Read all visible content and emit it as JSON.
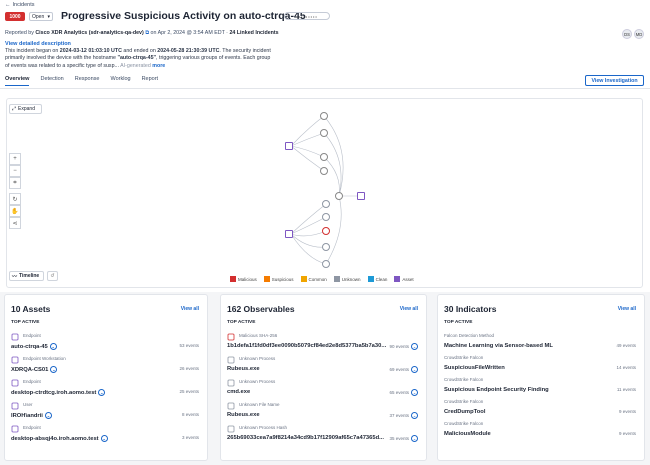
{
  "breadcrumb": "Incidents",
  "header": {
    "severity_score": "1000",
    "status": "Open",
    "title": "Progressive Suspicious Activity on auto-ctrqa-45",
    "more_label": "•••••••••"
  },
  "meta": {
    "reported_by_prefix": "Reported by",
    "reporter": "Cisco XDR Analytics (sdr-analytics-qa-dev)",
    "date_prefix": "on Apr 2, 2024 @ 3:54 AM EDT ·",
    "linked": "24 Linked Incidents"
  },
  "avatars": [
    "DS",
    "MD"
  ],
  "view_description": "View detailed description",
  "description": {
    "p1": "This incident began on ",
    "start": "2024-03-12 01:03:10 UTC",
    "p2": " and ended on ",
    "end": "2024-05-28 21:30:39 UTC",
    "p3": ". The security incident primarily involved the device with the hostname ",
    "host": "\"auto-ctrqa-45\"",
    "p4": ", triggering various groups of events. Each group of events was related to a specific type of susp...",
    "ai": "AI-generated",
    "more": "more"
  },
  "tabs": [
    "Overview",
    "Detection",
    "Response",
    "Worklog",
    "Report"
  ],
  "view_investigation": "View Investigation",
  "graph": {
    "expand": "Expand",
    "timeline": "Timeline",
    "legend": [
      {
        "label": "Malicious",
        "color": "#d32f2f"
      },
      {
        "label": "Suspicious",
        "color": "#f57c00"
      },
      {
        "label": "Common",
        "color": "#f0a500"
      },
      {
        "label": "Unknown",
        "color": "#8e96a3"
      },
      {
        "label": "Clean",
        "color": "#1e9ad6"
      },
      {
        "label": "Asset",
        "color": "#7e57c2"
      }
    ]
  },
  "assets": {
    "title": "10 Assets",
    "view_all": "View all",
    "sub": "TOP ACTIVE",
    "rows": [
      {
        "kind": "Endpoint",
        "value": "auto-ctrqa-45",
        "count": "53 events"
      },
      {
        "kind": "Endpoint Workstation",
        "value": "XDRQA-CS01",
        "count": "26 events"
      },
      {
        "kind": "Endpoint",
        "value": "desktop-ctrdtcg.iroh.aomo.test",
        "count": "25 events"
      },
      {
        "kind": "User",
        "value": "IROH\\andrii",
        "count": "8 events"
      },
      {
        "kind": "Endpoint",
        "value": "desktop-absqj4o.iroh.aomo.test",
        "count": "3 events"
      }
    ]
  },
  "observables": {
    "title": "162 Observables",
    "view_all": "View all",
    "sub": "TOP ACTIVE",
    "rows": [
      {
        "kind": "Malicious SHA-256",
        "value": "1b1defa1f1fd0df3ee0090b5079cf84ed2e8d5377ba5b7a30...",
        "count": "90 events",
        "color": "#d32f2f"
      },
      {
        "kind": "Unknown Process",
        "value": "Rubeus.exe",
        "count": "69 events",
        "color": "#8e96a3"
      },
      {
        "kind": "Unknown Process",
        "value": "cmd.exe",
        "count": "65 events",
        "color": "#8e96a3"
      },
      {
        "kind": "Unknown File Name",
        "value": "Rubeus.exe",
        "count": "37 events",
        "color": "#8e96a3"
      },
      {
        "kind": "Unknown Process Hash",
        "value": "265b69033cea7a9f8214a34cd9b17f12909af65c7a47365d...",
        "count": "35 events",
        "color": "#8e96a3"
      }
    ]
  },
  "indicators": {
    "title": "30 Indicators",
    "view_all": "View all",
    "sub": "TOP ACTIVE",
    "rows": [
      {
        "kind": "Falcon Detection Method",
        "value": "Machine Learning via Sensor-based ML",
        "count": "49 events"
      },
      {
        "kind": "CrowdStrike Falcon",
        "value": "SuspiciousFileWritten",
        "count": "14 events"
      },
      {
        "kind": "CrowdStrike Falcon",
        "value": "Suspicious Endpoint Security Finding",
        "count": "11 events"
      },
      {
        "kind": "CrowdStrike Falcon",
        "value": "CredDumpTool",
        "count": "9 events"
      },
      {
        "kind": "CrowdStrike Falcon",
        "value": "MaliciousModule",
        "count": "9 events"
      }
    ]
  }
}
